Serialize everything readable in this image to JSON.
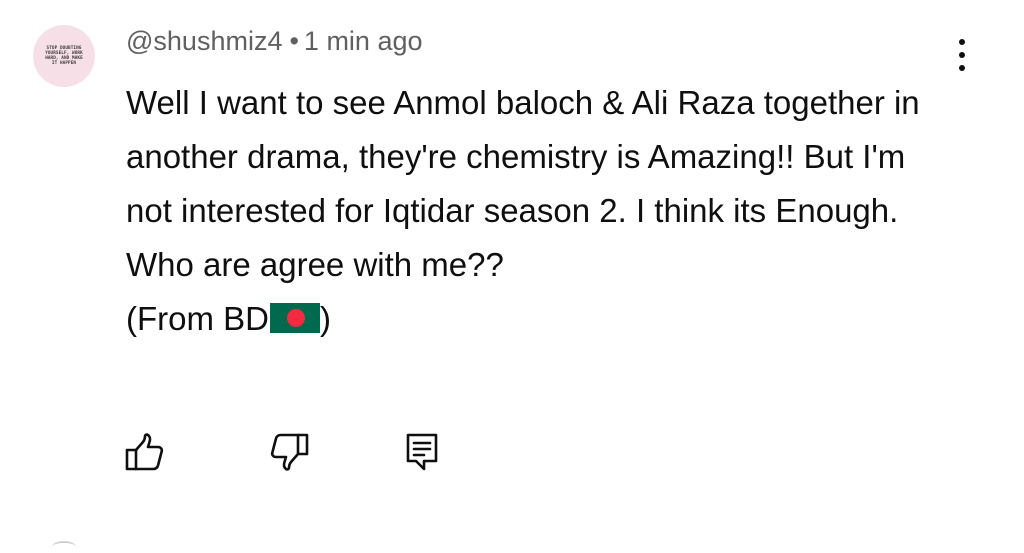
{
  "comment": {
    "avatar_text": "STOP DOUBTING YOURSELF, WORK HARD, AND MAKE IT HAPPEN",
    "username": "@shushmiz4",
    "separator": "•",
    "timestamp": "1 min ago",
    "body_lines": [
      "Well I want to see Anmol baloch & Ali Raza together in another drama, they're chemistry is Amazing!!  But I'm not interested for Iqtidar season 2. I think its Enough. Who are agree with me??",
      "(From BD",
      ")"
    ],
    "flag_emoji": "bangladesh-flag"
  },
  "actions": {
    "like_icon": "thumbs-up-icon",
    "dislike_icon": "thumbs-down-icon",
    "reply_icon": "reply-comment-icon",
    "menu_icon": "more-vertical-icon"
  },
  "colors": {
    "text_primary": "#0f0f0f",
    "text_secondary": "#606060",
    "avatar_bg": "#f6dfe6",
    "flag_green": "#006a4e",
    "flag_red": "#f42a41"
  }
}
